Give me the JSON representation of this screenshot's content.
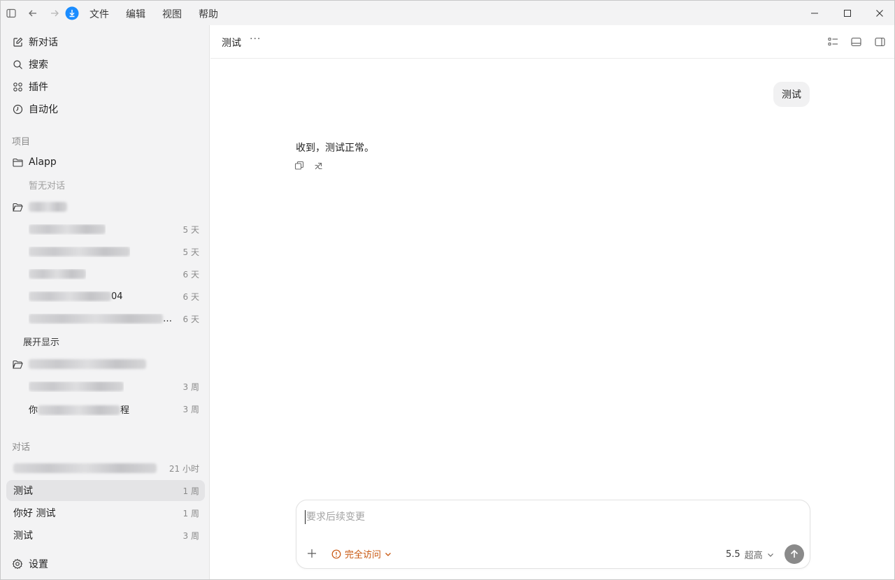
{
  "menu": {
    "items": [
      "文件",
      "编辑",
      "视图",
      "帮助"
    ]
  },
  "sidebar": {
    "nav": [
      {
        "label": "新对话",
        "icon": "edit-icon"
      },
      {
        "label": "搜索",
        "icon": "search-icon"
      },
      {
        "label": "插件",
        "icon": "plugins-icon"
      },
      {
        "label": "自动化",
        "icon": "clock-icon"
      }
    ],
    "projects_label": "项目",
    "project1": {
      "name": "Alapp",
      "empty": "暂无对话"
    },
    "project2": {
      "conversations": [
        {
          "time": "5 天"
        },
        {
          "time": "5 天"
        },
        {
          "time": "6 天"
        },
        {
          "title_suffix": "04",
          "time": "6 天"
        },
        {
          "title_suffix": "…",
          "time": "6 天"
        }
      ],
      "expand": "展开显示"
    },
    "project3": {
      "conversations": [
        {
          "time": "3 周"
        },
        {
          "title_prefix": "你",
          "title_suffix": "程",
          "time": "3 周"
        }
      ]
    },
    "chats_label": "对话",
    "chats": [
      {
        "title": "",
        "time": "21 小时"
      },
      {
        "title": "测试",
        "time": "1 周"
      },
      {
        "title": "你好 测试",
        "time": "1 周"
      },
      {
        "title": "测试",
        "time": "3 周"
      }
    ],
    "settings": "设置"
  },
  "main": {
    "title": "测试",
    "more": "···",
    "user_message": "测试",
    "assistant_message": "收到，测试正常。",
    "composer": {
      "placeholder": "要求后续变更",
      "access": "完全访问",
      "model": "5.5",
      "level": "超高"
    }
  },
  "colors": {
    "accent_orange": "#c8560e",
    "app_icon_blue": "#1a8cff",
    "sidebar_bg": "#f3f3f4",
    "active_row": "#e4e4e6"
  }
}
